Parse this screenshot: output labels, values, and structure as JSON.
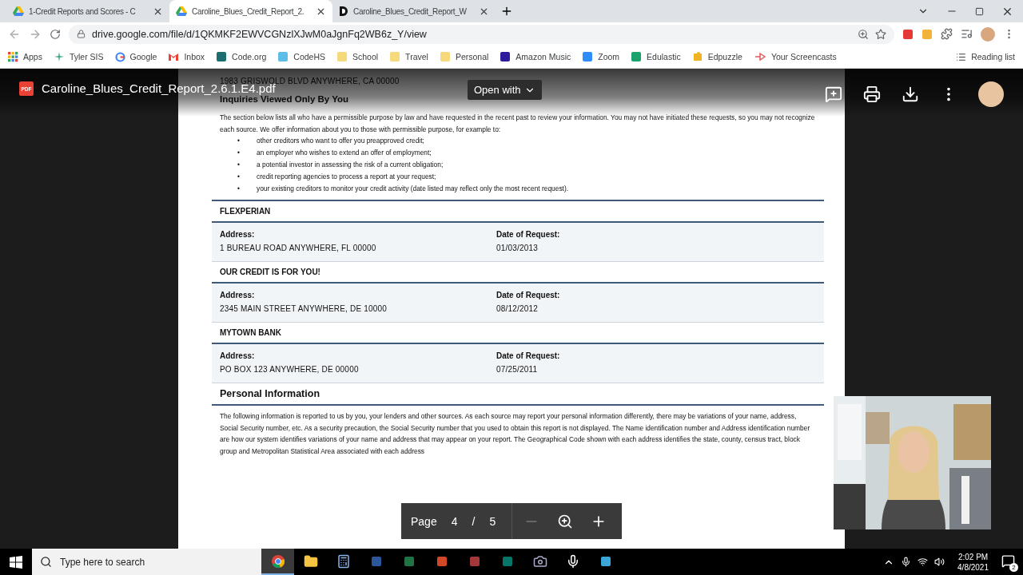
{
  "browser": {
    "tabs": [
      {
        "title": "1-Credit Reports and Scores - C",
        "kind": "drive",
        "selected": false
      },
      {
        "title": "Caroline_Blues_Credit_Report_2.",
        "kind": "drive",
        "selected": true
      },
      {
        "title": "Caroline_Blues_Credit_Report_W",
        "kind": "doc",
        "selected": false
      }
    ],
    "url": "drive.google.com/file/d/1QKMKF2EWVCGNzlXJwM0aJgnFq2WB6z_Y/view",
    "bookmarks": [
      {
        "label": "Apps",
        "kind": "apps"
      },
      {
        "label": "Tyler SIS",
        "kind": "tyler"
      },
      {
        "label": "Google",
        "kind": "google"
      },
      {
        "label": "Inbox",
        "kind": "gmail"
      },
      {
        "label": "Code.org",
        "kind": "codeorg"
      },
      {
        "label": "CodeHS",
        "kind": "codehs"
      },
      {
        "label": "School",
        "kind": "folder"
      },
      {
        "label": "Travel",
        "kind": "folder"
      },
      {
        "label": "Personal",
        "kind": "folder"
      },
      {
        "label": "Amazon Music",
        "kind": "amazon"
      },
      {
        "label": "Zoom",
        "kind": "zoom"
      },
      {
        "label": "Edulastic",
        "kind": "edulastic"
      },
      {
        "label": "Edpuzzle",
        "kind": "edpuzzle"
      },
      {
        "label": "Your Screencasts",
        "kind": "screencast"
      }
    ],
    "reading_list": "Reading list"
  },
  "viewer": {
    "file_name": "Caroline_Blues_Credit_Report_2.6.1.E4.pdf",
    "file_badge": "PDF",
    "open_with": "Open with",
    "page_label": "Page",
    "page": "4",
    "separator": "/",
    "total": "5"
  },
  "document": {
    "top_entry": {
      "address": "1983 GRISWOLD BLVD ANYWHERE, CA 00000"
    },
    "inquiries": {
      "heading": "Inquiries Viewed Only By You",
      "paragraph": "The section below lists all who have a permissible purpose by law and have requested in the recent past to review your information. You may not have initiated these requests, so you may not recognize each source. We offer information about you to those with permissible purpose, for example to:",
      "bullets": [
        {
          "mark": "•",
          "text": "other creditors who want to offer you preapproved credit;"
        },
        {
          "mark": "•",
          "text": "an employer who wishes to extend an offer of employment;"
        },
        {
          "mark": "•",
          "text": "a potential investor in assessing the risk of a current obligation;"
        },
        {
          "mark": "•",
          "text": "credit reporting agencies to process a report at your request;"
        },
        {
          "mark": "•",
          "text": "your existing creditors to monitor your credit activity (date listed may reflect only the most recent request)."
        }
      ],
      "entries": [
        {
          "name": "FLEXPERIAN",
          "address_label": "Address:",
          "address": "1 BUREAU ROAD  ANYWHERE, FL 00000",
          "date_label": "Date of Request:",
          "date": "01/03/2013"
        },
        {
          "name": "OUR CREDIT IS FOR YOU!",
          "address_label": "Address:",
          "address": "2345 MAIN STREET ANYWHERE, DE 10000",
          "date_label": "Date of Request:",
          "date": "08/12/2012"
        },
        {
          "name": "MYTOWN BANK",
          "address_label": "Address:",
          "address": "PO BOX 123  ANYWHERE, DE 00000",
          "date_label": "Date of Request:",
          "date": "07/25/2011"
        }
      ]
    },
    "personal": {
      "heading": "Personal Information",
      "paragraph": "The following information is reported to us by you, your lenders and other sources. As each source may report your personal information differently, there may be variations of your name, address, Social Security number, etc. As a security precaution, the Social Security number that you used to obtain this report is not displayed. The Name identification number and Address identification number are how our system identifies variations of your name and address that may appear on your report. The Geographical Code shown with each address identifies the state, county, census tract, block group and Metropolitan Statistical Area associated with each address"
    }
  },
  "taskbar": {
    "search_placeholder": "Type here to search",
    "apps": [
      {
        "kind": "chrome",
        "selected": true
      },
      {
        "kind": "explorer",
        "selected": false
      },
      {
        "kind": "calculator",
        "selected": false
      },
      {
        "kind": "word",
        "selected": false
      },
      {
        "kind": "excel",
        "selected": false
      },
      {
        "kind": "powerpoint",
        "selected": false
      },
      {
        "kind": "access",
        "selected": false
      },
      {
        "kind": "publisher",
        "selected": false
      },
      {
        "kind": "camera",
        "selected": false
      },
      {
        "kind": "mic",
        "selected": false
      },
      {
        "kind": "store",
        "selected": false
      }
    ],
    "time": "2:02 PM",
    "date": "4/8/2021",
    "notifications": "2"
  }
}
